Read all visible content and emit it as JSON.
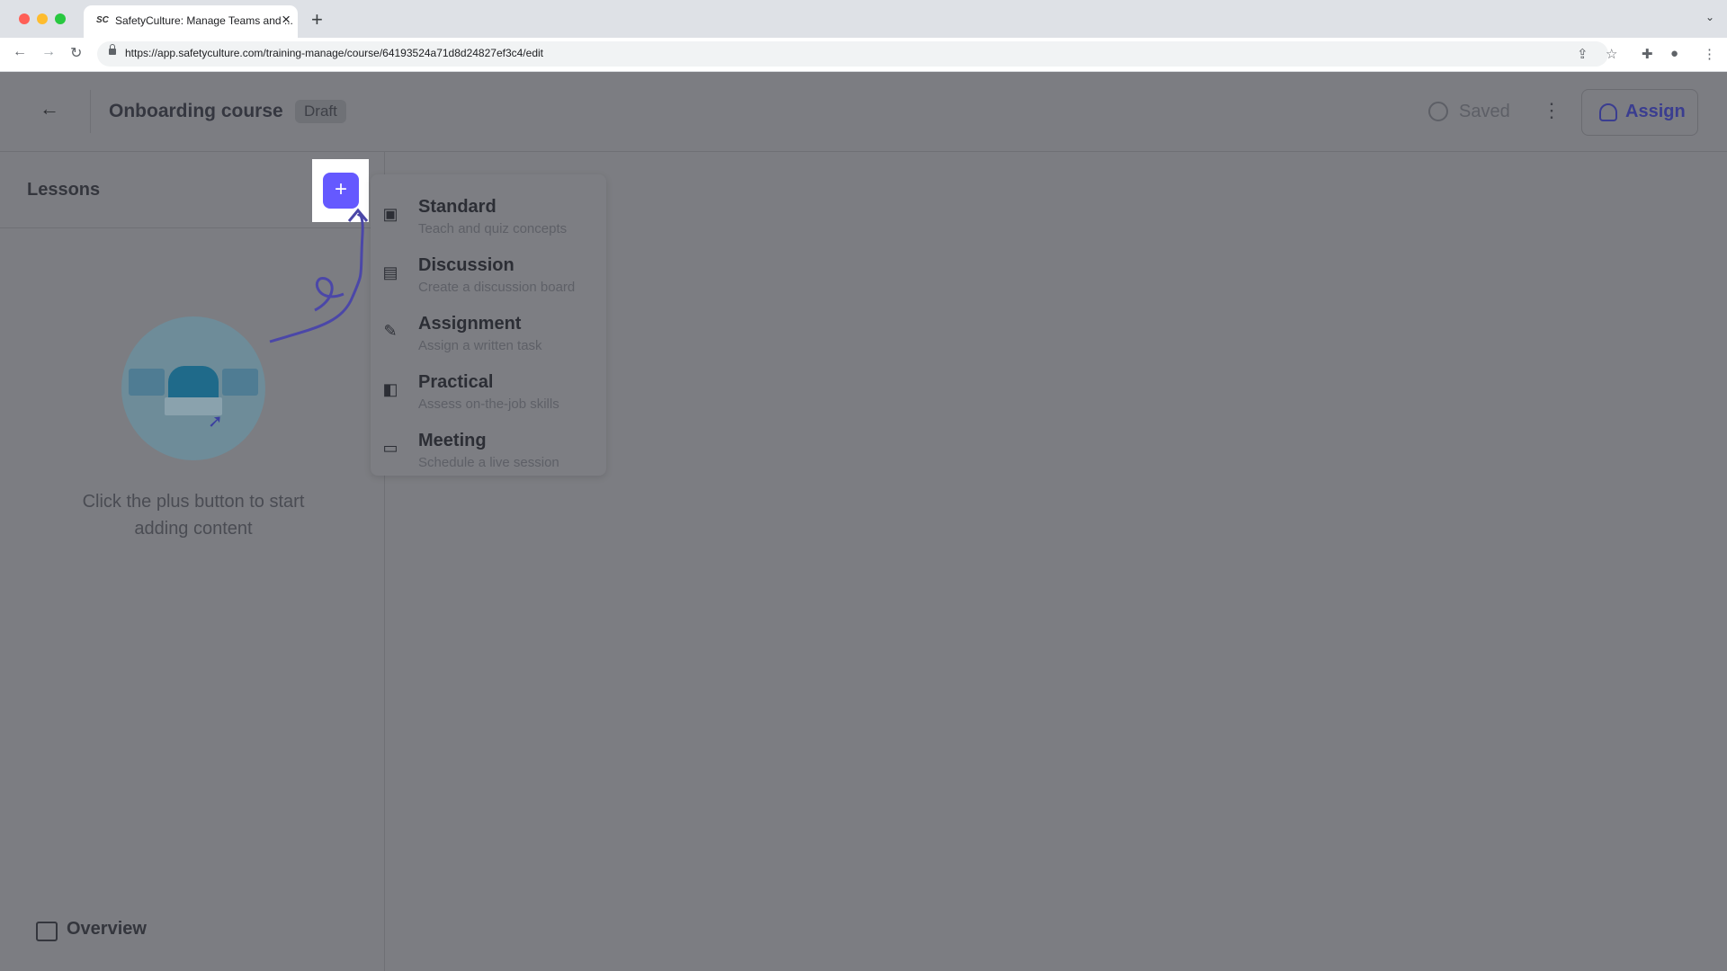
{
  "browser": {
    "tab_title": "SafetyCulture: Manage Teams and ...",
    "tab_favicon": "SC",
    "url": "https://app.safetyculture.com/training-manage/course/64193524a71d8d24827ef3c4/edit",
    "icons": {
      "back": "arrow-left-icon",
      "forward": "arrow-right-icon",
      "reload": "reload-icon",
      "share": "share-icon",
      "bookmark": "star-icon",
      "extensions": "puzzle-icon",
      "profile": "profile-icon",
      "menu": "kebab-icon"
    },
    "traffic_colors": [
      "#ff5f57",
      "#febc2e",
      "#28c840"
    ]
  },
  "header": {
    "course_title": "Onboarding course",
    "status_badge": "Draft",
    "save_status": "Saved",
    "assign_label": "Assign"
  },
  "sidebar": {
    "title": "Lessons",
    "empty_message": "Click the plus button to start adding content",
    "overview_label": "Overview"
  },
  "add_menu": {
    "items": [
      {
        "label": "Standard",
        "description": "Teach and quiz concepts",
        "icon": "standard-icon"
      },
      {
        "label": "Discussion",
        "description": "Create a discussion board",
        "icon": "discussion-icon"
      },
      {
        "label": "Assignment",
        "description": "Assign a written task",
        "icon": "pencil-icon"
      },
      {
        "label": "Practical",
        "description": "Assess on-the-job skills",
        "icon": "practical-icon"
      },
      {
        "label": "Meeting",
        "description": "Schedule a live session",
        "icon": "calendar-icon"
      }
    ]
  },
  "colors": {
    "accent": "#6559ff",
    "overlay": "#7c7d82"
  }
}
